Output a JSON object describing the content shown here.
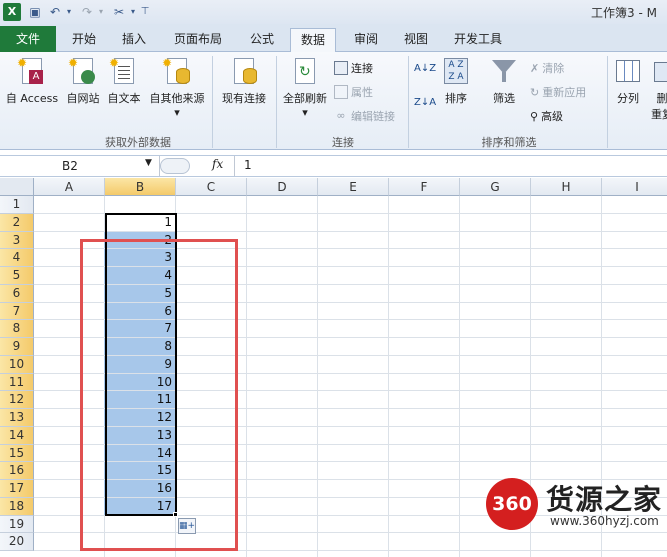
{
  "title_bar": {
    "app_icon": "X",
    "title": "工作簿3 - M"
  },
  "quick_access": {
    "save_icon": "save-icon",
    "undo_icon": "undo-icon",
    "redo_icon": "redo-icon",
    "custom_icon": "customize-icon"
  },
  "tabs": {
    "file": "文件",
    "home": "开始",
    "insert": "插入",
    "page_layout": "页面布局",
    "formulas": "公式",
    "data": "数据",
    "review": "审阅",
    "view": "视图",
    "developer": "开发工具"
  },
  "ribbon": {
    "get_external": {
      "access": "自 Access",
      "web": "自网站",
      "text": "自文本",
      "other": "自其他来源",
      "other_arrow": "▾",
      "existing": "现有连接",
      "label": "获取外部数据"
    },
    "connections": {
      "refresh_all": "全部刷新",
      "refresh_arrow": "▾",
      "connections": "连接",
      "properties": "属性",
      "edit_links": "编辑链接",
      "label": "连接"
    },
    "sort_filter": {
      "sort_az_icon": "A↓Z",
      "sort_za_icon": "Z↓A",
      "sort": "排序",
      "filter": "筛选",
      "clear": "清除",
      "reapply": "重新应用",
      "advanced": "高级",
      "label": "排序和筛选"
    },
    "tools": {
      "split": "分列",
      "delete_dup": "删",
      "delete_dup2": "重复"
    }
  },
  "formula_bar": {
    "name_box": "B2",
    "fx": "fx",
    "value": "1"
  },
  "columns": [
    "A",
    "B",
    "C",
    "D",
    "E",
    "F",
    "G",
    "H",
    "I"
  ],
  "rows": [
    "1",
    "2",
    "3",
    "4",
    "5",
    "6",
    "7",
    "8",
    "9",
    "10",
    "11",
    "12",
    "13",
    "14",
    "15",
    "16",
    "17",
    "18",
    "19",
    "20"
  ],
  "column_b_values": [
    "",
    "1",
    "2",
    "3",
    "4",
    "5",
    "6",
    "7",
    "8",
    "9",
    "10",
    "11",
    "12",
    "13",
    "14",
    "15",
    "16",
    "17"
  ],
  "selected_column": "B",
  "watermark": {
    "logo": "360",
    "name": "货源之家",
    "url": "www.360hyzj.com"
  }
}
